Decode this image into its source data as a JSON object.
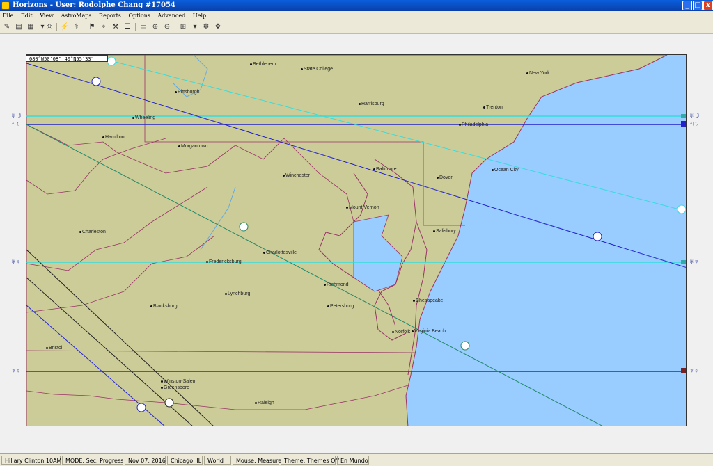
{
  "window": {
    "title": "Horizons - User: Rodolphe Chang #17054",
    "min": "_",
    "max": "□",
    "close": "x"
  },
  "menu": [
    "File",
    "Edit",
    "View",
    "AstroMaps",
    "Reports",
    "Options",
    "Advanced",
    "Help"
  ],
  "map": {
    "coordinates": "080°W50'08\"   40°N55'33\"",
    "cities": [
      {
        "name": "Bethlehem"
      },
      {
        "name": "State College"
      },
      {
        "name": "New York"
      },
      {
        "name": "Pittsburgh"
      },
      {
        "name": "Harrisburg"
      },
      {
        "name": "Trenton"
      },
      {
        "name": "Wheeling"
      },
      {
        "name": "Philadelphia"
      },
      {
        "name": "Hamilton"
      },
      {
        "name": "Morgantown"
      },
      {
        "name": "Baltimore"
      },
      {
        "name": "Ocean City"
      },
      {
        "name": "Winchester"
      },
      {
        "name": "Dover"
      },
      {
        "name": "Mount Vernon"
      },
      {
        "name": "Charleston"
      },
      {
        "name": "Salisbury"
      },
      {
        "name": "Charlottesville"
      },
      {
        "name": "Fredericksburg"
      },
      {
        "name": "Richmond"
      },
      {
        "name": "Lynchburg"
      },
      {
        "name": "Chesapeake"
      },
      {
        "name": "Blacksburg"
      },
      {
        "name": "Petersburg"
      },
      {
        "name": "Norfolk"
      },
      {
        "name": "Virginia Beach"
      },
      {
        "name": "Bristol"
      },
      {
        "name": "Winston-Salem"
      },
      {
        "name": "Greensboro"
      },
      {
        "name": "Raleigh"
      }
    ],
    "left_labels": [
      "♅☽",
      "♃♄",
      "♅♆",
      "♆♀"
    ],
    "right_labels": [
      "♅☽",
      "♃♄",
      "♅♆",
      "♆♀"
    ],
    "colors": {
      "water": "#99ccff",
      "land": "#cccc99",
      "border": "#993366",
      "jupiter": "#2222cc",
      "uranus": "#33dddd",
      "green": "#228866",
      "venus": "#772222"
    }
  },
  "status": [
    "Hillary Clinton 10AM",
    "MODE: Sec. Progress",
    "Nov 07, 2016",
    "Chicago, IL",
    "World",
    "Mouse: Measure",
    "Theme: Themes Off",
    "En Mundo"
  ]
}
